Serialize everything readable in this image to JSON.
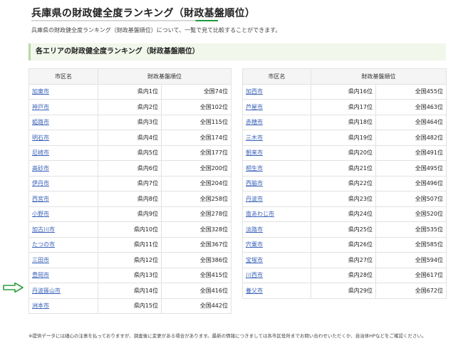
{
  "page": {
    "title": "兵庫県の財政健全度ランキング（財政基盤順位）",
    "intro": "兵庫県の財政健全度ランキング（財政基盤順位）について、一覧で見て比較することができます。"
  },
  "section": {
    "heading": "各エリアの財政健全度ランキング（財政基盤順位）"
  },
  "table_headers": {
    "city": "市区名",
    "rank": "財政基盤順位"
  },
  "left_rows": [
    {
      "city": "加東市",
      "pref": "県内1位",
      "nat": "全国74位"
    },
    {
      "city": "神戸市",
      "pref": "県内2位",
      "nat": "全国102位"
    },
    {
      "city": "姫路市",
      "pref": "県内3位",
      "nat": "全国115位"
    },
    {
      "city": "明石市",
      "pref": "県内4位",
      "nat": "全国174位"
    },
    {
      "city": "尼崎市",
      "pref": "県内5位",
      "nat": "全国177位"
    },
    {
      "city": "高砂市",
      "pref": "県内6位",
      "nat": "全国200位"
    },
    {
      "city": "伊丹市",
      "pref": "県内7位",
      "nat": "全国204位"
    },
    {
      "city": "西宮市",
      "pref": "県内8位",
      "nat": "全国258位"
    },
    {
      "city": "小野市",
      "pref": "県内9位",
      "nat": "全国278位"
    },
    {
      "city": "加古川市",
      "pref": "県内10位",
      "nat": "全国328位"
    },
    {
      "city": "たつの市",
      "pref": "県内11位",
      "nat": "全国367位"
    },
    {
      "city": "三田市",
      "pref": "県内12位",
      "nat": "全国386位"
    },
    {
      "city": "豊岡市",
      "pref": "県内13位",
      "nat": "全国415位"
    },
    {
      "city": "丹波篠山市",
      "pref": "県内14位",
      "nat": "全国416位"
    },
    {
      "city": "洲本市",
      "pref": "県内15位",
      "nat": "全国442位"
    }
  ],
  "right_rows": [
    {
      "city": "加西市",
      "pref": "県内16位",
      "nat": "全国455位"
    },
    {
      "city": "芦屋市",
      "pref": "県内17位",
      "nat": "全国463位"
    },
    {
      "city": "赤穂市",
      "pref": "県内18位",
      "nat": "全国464位"
    },
    {
      "city": "三木市",
      "pref": "県内19位",
      "nat": "全国482位"
    },
    {
      "city": "朝来市",
      "pref": "県内20位",
      "nat": "全国491位"
    },
    {
      "city": "相生市",
      "pref": "県内21位",
      "nat": "全国495位"
    },
    {
      "city": "西脇市",
      "pref": "県内22位",
      "nat": "全国496位"
    },
    {
      "city": "丹波市",
      "pref": "県内23位",
      "nat": "全国507位"
    },
    {
      "city": "南あわじ市",
      "pref": "県内24位",
      "nat": "全国520位"
    },
    {
      "city": "淡路市",
      "pref": "県内25位",
      "nat": "全国535位"
    },
    {
      "city": "宍粟市",
      "pref": "県内26位",
      "nat": "全国585位"
    },
    {
      "city": "宝塚市",
      "pref": "県内27位",
      "nat": "全国594位"
    },
    {
      "city": "川西市",
      "pref": "県内28位",
      "nat": "全国617位"
    },
    {
      "city": "養父市",
      "pref": "県内29位",
      "nat": "全国672位"
    }
  ],
  "footnote": "※提供データには細心の注意を払っておりますが、調査後に変更がある場合があります。最新の情報につきましては各市区役所までお問い合わせいただくか、自治体HPなどをご確認ください。",
  "annotations": {
    "arrow_icon": "right-arrow-icon",
    "arrow_color": "#2e9e3e"
  },
  "colors": {
    "link": "#3a62b8",
    "accent_green": "#1f9a3b",
    "section_bg": "#f1f7ea"
  }
}
